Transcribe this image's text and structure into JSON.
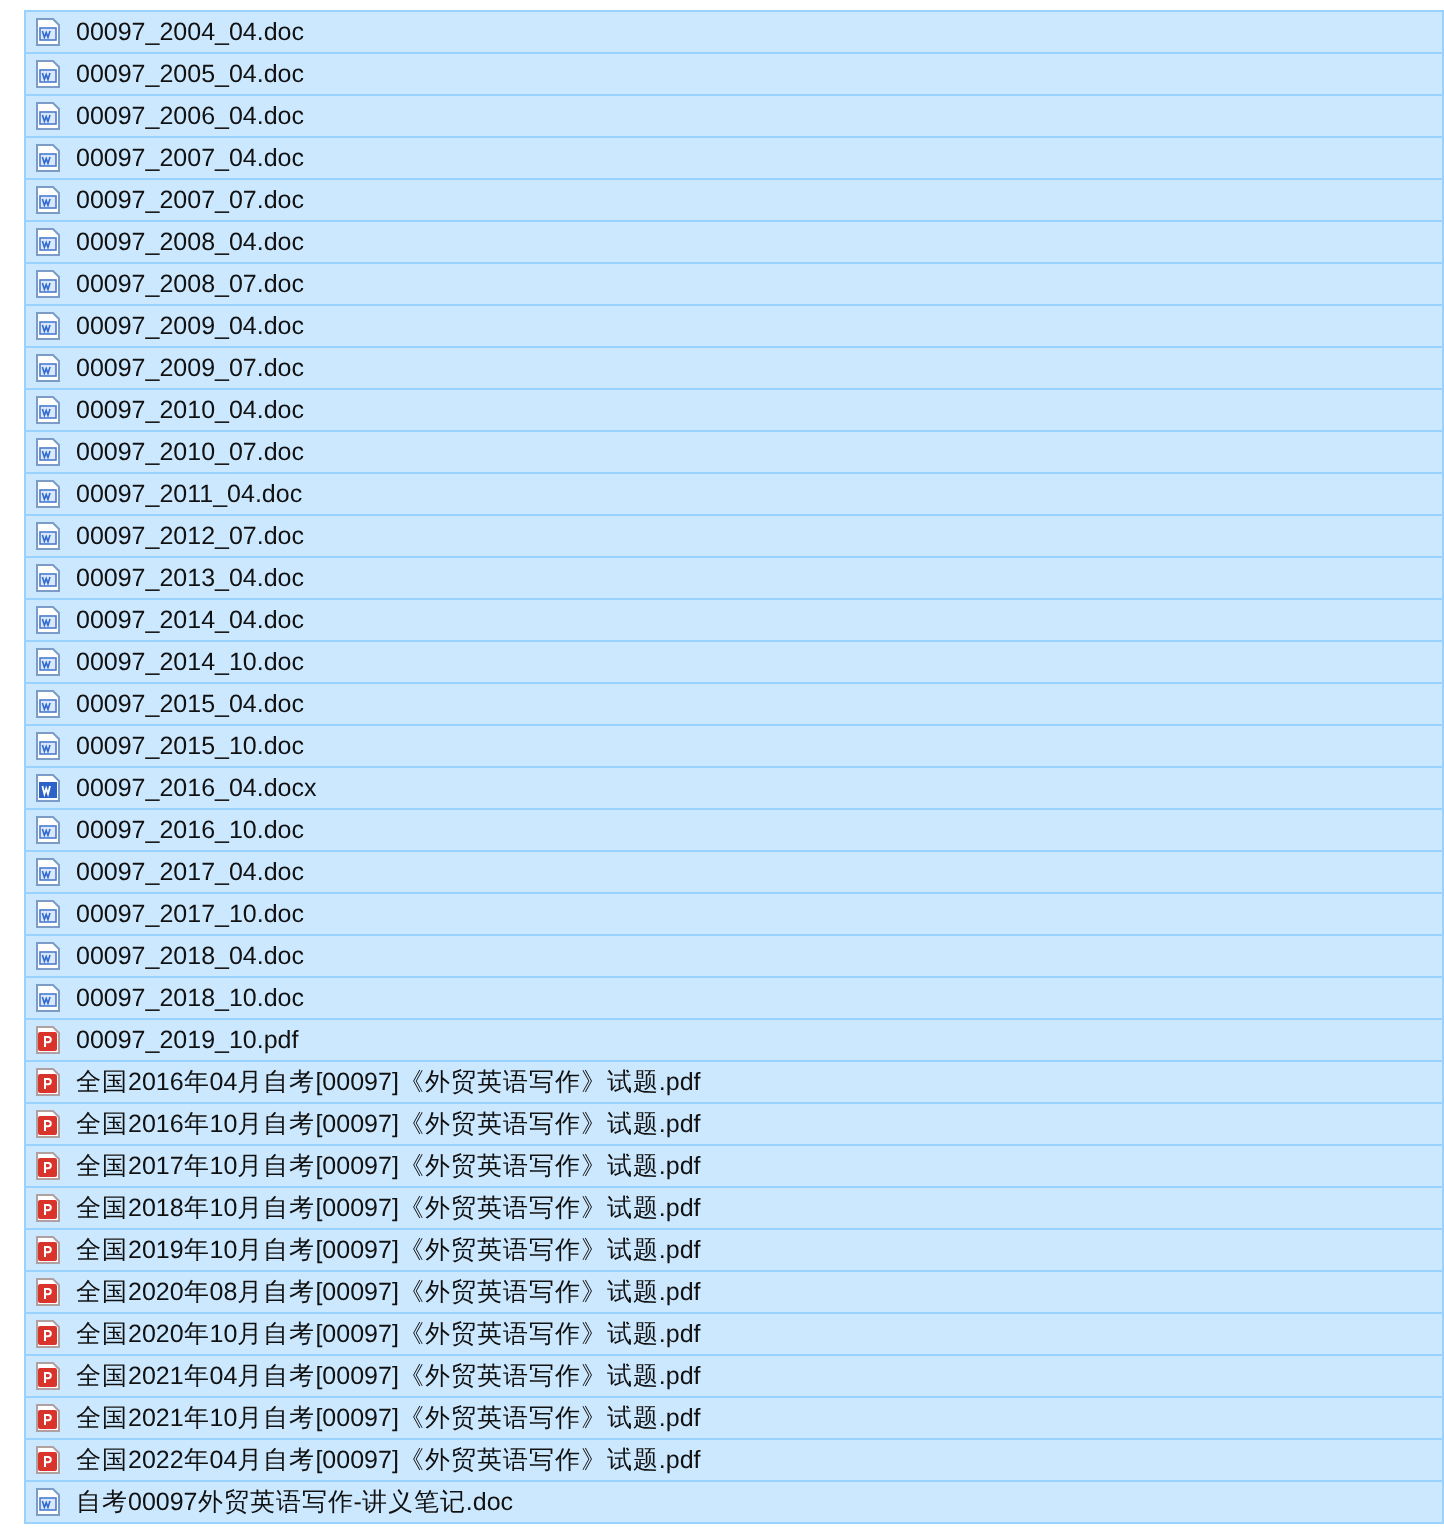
{
  "files": [
    {
      "name": "00097_2004_04.doc",
      "kind": "doc",
      "selected": true
    },
    {
      "name": "00097_2005_04.doc",
      "kind": "doc",
      "selected": true
    },
    {
      "name": "00097_2006_04.doc",
      "kind": "doc",
      "selected": true
    },
    {
      "name": "00097_2007_04.doc",
      "kind": "doc",
      "selected": true
    },
    {
      "name": "00097_2007_07.doc",
      "kind": "doc",
      "selected": true
    },
    {
      "name": "00097_2008_04.doc",
      "kind": "doc",
      "selected": true
    },
    {
      "name": "00097_2008_07.doc",
      "kind": "doc",
      "selected": true
    },
    {
      "name": "00097_2009_04.doc",
      "kind": "doc",
      "selected": true
    },
    {
      "name": "00097_2009_07.doc",
      "kind": "doc",
      "selected": true
    },
    {
      "name": "00097_2010_04.doc",
      "kind": "doc",
      "selected": true
    },
    {
      "name": "00097_2010_07.doc",
      "kind": "doc",
      "selected": true
    },
    {
      "name": "00097_2011_04.doc",
      "kind": "doc",
      "selected": true
    },
    {
      "name": "00097_2012_07.doc",
      "kind": "doc",
      "selected": true
    },
    {
      "name": "00097_2013_04.doc",
      "kind": "doc",
      "selected": true
    },
    {
      "name": "00097_2014_04.doc",
      "kind": "doc",
      "selected": true
    },
    {
      "name": "00097_2014_10.doc",
      "kind": "doc",
      "selected": true
    },
    {
      "name": "00097_2015_04.doc",
      "kind": "doc",
      "selected": true
    },
    {
      "name": "00097_2015_10.doc",
      "kind": "doc",
      "selected": true
    },
    {
      "name": "00097_2016_04.docx",
      "kind": "docx",
      "selected": true
    },
    {
      "name": "00097_2016_10.doc",
      "kind": "doc",
      "selected": true
    },
    {
      "name": "00097_2017_04.doc",
      "kind": "doc",
      "selected": true
    },
    {
      "name": "00097_2017_10.doc",
      "kind": "doc",
      "selected": true
    },
    {
      "name": "00097_2018_04.doc",
      "kind": "doc",
      "selected": true
    },
    {
      "name": "00097_2018_10.doc",
      "kind": "doc",
      "selected": true
    },
    {
      "name": "00097_2019_10.pdf",
      "kind": "pdf",
      "selected": true
    },
    {
      "name": "全国2016年04月自考[00097]《外贸英语写作》试题.pdf",
      "kind": "pdf",
      "selected": true
    },
    {
      "name": "全国2016年10月自考[00097]《外贸英语写作》试题.pdf",
      "kind": "pdf",
      "selected": true
    },
    {
      "name": "全国2017年10月自考[00097]《外贸英语写作》试题.pdf",
      "kind": "pdf",
      "selected": true
    },
    {
      "name": "全国2018年10月自考[00097]《外贸英语写作》试题.pdf",
      "kind": "pdf",
      "selected": true
    },
    {
      "name": "全国2019年10月自考[00097]《外贸英语写作》试题.pdf",
      "kind": "pdf",
      "selected": true
    },
    {
      "name": "全国2020年08月自考[00097]《外贸英语写作》试题.pdf",
      "kind": "pdf",
      "selected": true
    },
    {
      "name": "全国2020年10月自考[00097]《外贸英语写作》试题.pdf",
      "kind": "pdf",
      "selected": true
    },
    {
      "name": "全国2021年04月自考[00097]《外贸英语写作》试题.pdf",
      "kind": "pdf",
      "selected": true
    },
    {
      "name": "全国2021年10月自考[00097]《外贸英语写作》试题.pdf",
      "kind": "pdf",
      "selected": true
    },
    {
      "name": "全国2022年04月自考[00097]《外贸英语写作》试题.pdf",
      "kind": "pdf",
      "selected": true
    },
    {
      "name": "自考00097外贸英语写作-讲义笔记.doc",
      "kind": "doc",
      "selected": true
    }
  ]
}
